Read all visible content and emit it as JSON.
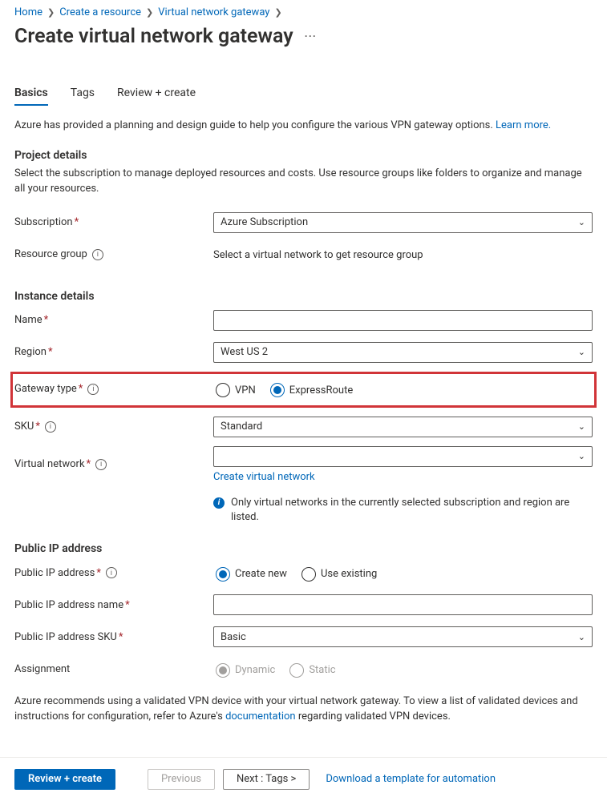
{
  "breadcrumb": {
    "home": "Home",
    "create_resource": "Create a resource",
    "vng": "Virtual network gateway"
  },
  "page_title": "Create virtual network gateway",
  "tabs": {
    "basics": "Basics",
    "tags": "Tags",
    "review": "Review + create"
  },
  "intro_text": "Azure has provided a planning and design guide to help you configure the various VPN gateway options.  ",
  "learn_more": "Learn more.",
  "project": {
    "heading": "Project details",
    "desc": "Select the subscription to manage deployed resources and costs. Use resource groups like folders to organize and manage all your resources.",
    "subscription_label": "Subscription",
    "subscription_value": "Azure Subscription",
    "rg_label": "Resource group",
    "rg_value": "Select a virtual network to get resource group"
  },
  "instance": {
    "heading": "Instance details",
    "name_label": "Name",
    "region_label": "Region",
    "region_value": "West US 2",
    "gateway_type_label": "Gateway type",
    "gateway_vpn": "VPN",
    "gateway_er": "ExpressRoute",
    "sku_label": "SKU",
    "sku_value": "Standard",
    "vnet_label": "Virtual network",
    "create_vnet": "Create virtual network",
    "vnet_note": "Only virtual networks in the currently selected subscription and region are listed."
  },
  "public_ip": {
    "heading": "Public IP address",
    "addr_label": "Public IP address",
    "create_new": "Create new",
    "use_existing": "Use existing",
    "name_label": "Public IP address name",
    "sku_label": "Public IP address SKU",
    "sku_value": "Basic",
    "assignment_label": "Assignment",
    "dynamic": "Dynamic",
    "static": "Static"
  },
  "footer_note_pre": "Azure recommends using a validated VPN device with your virtual network gateway. To view a list of validated devices and instructions for configuration, refer to Azure's ",
  "footer_note_link": "documentation",
  "footer_note_post": " regarding validated VPN devices.",
  "buttons": {
    "review": "Review + create",
    "previous": "Previous",
    "next": "Next : Tags >",
    "download": "Download a template for automation"
  }
}
